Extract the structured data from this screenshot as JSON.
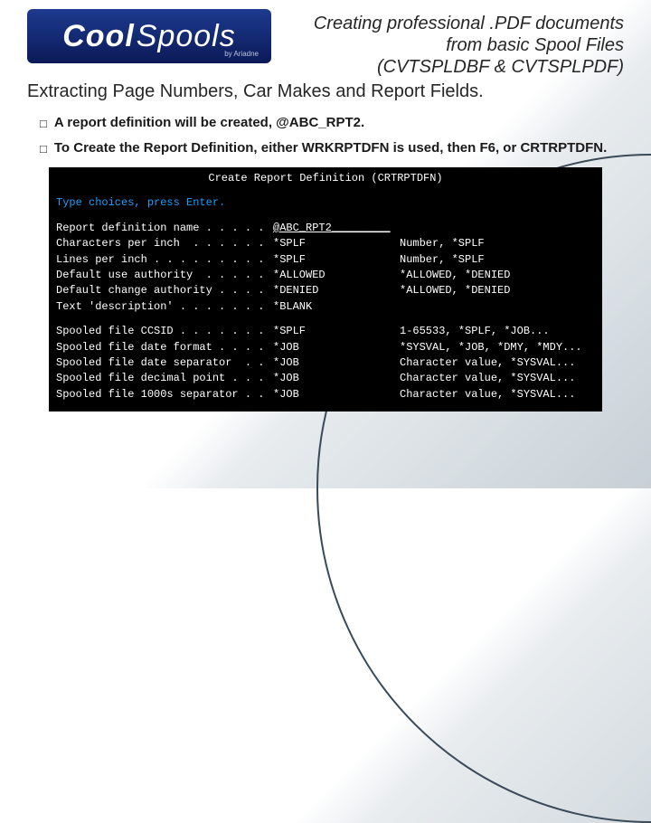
{
  "logo": {
    "part1": "Cool",
    "part2": "Spools",
    "byline": "by Ariadne"
  },
  "header": {
    "line1": "Creating professional .PDF documents",
    "line2": "from basic Spool Files",
    "line3": "(CVTSPLDBF & CVTSPLPDF)"
  },
  "subtitle": "Extracting Page Numbers, Car Makes and Report Fields.",
  "bullets": [
    "A report definition will be created, @ABC_RPT2.",
    "To Create the Report Definition, either WRKRPTDFN is used, then F6, or CRTRPTDFN."
  ],
  "terminal": {
    "title": "Create Report Definition (CRTRPTDFN)",
    "instruction": "Type choices, press Enter.",
    "group1": [
      {
        "label": "Report definition name . . . . .",
        "value": "@ABC_RPT2_________",
        "hint": "",
        "input": true
      },
      {
        "label": "Characters per inch  . . . . . .",
        "value": "*SPLF",
        "hint": "Number, *SPLF"
      },
      {
        "label": "Lines per inch . . . . . . . . .",
        "value": "*SPLF",
        "hint": "Number, *SPLF"
      },
      {
        "label": "Default use authority  . . . . .",
        "value": "*ALLOWED",
        "hint": "*ALLOWED, *DENIED"
      },
      {
        "label": "Default change authority . . . .",
        "value": "*DENIED",
        "hint": "*ALLOWED, *DENIED"
      },
      {
        "label": "Text 'description' . . . . . . .",
        "value": "*BLANK",
        "hint": ""
      }
    ],
    "group2": [
      {
        "label": "Spooled file CCSID . . . . . . .",
        "value": "*SPLF",
        "hint": "1-65533, *SPLF, *JOB..."
      },
      {
        "label": "Spooled file date format . . . .",
        "value": "*JOB",
        "hint": "*SYSVAL, *JOB, *DMY, *MDY..."
      },
      {
        "label": "Spooled file date separator  . .",
        "value": "*JOB",
        "hint": "Character value, *SYSVAL..."
      },
      {
        "label": "Spooled file decimal point . . .",
        "value": "*JOB",
        "hint": "Character value, *SYSVAL..."
      },
      {
        "label": "Spooled file 1000s separator . .",
        "value": "*JOB",
        "hint": "Character value, *SYSVAL..."
      }
    ]
  }
}
